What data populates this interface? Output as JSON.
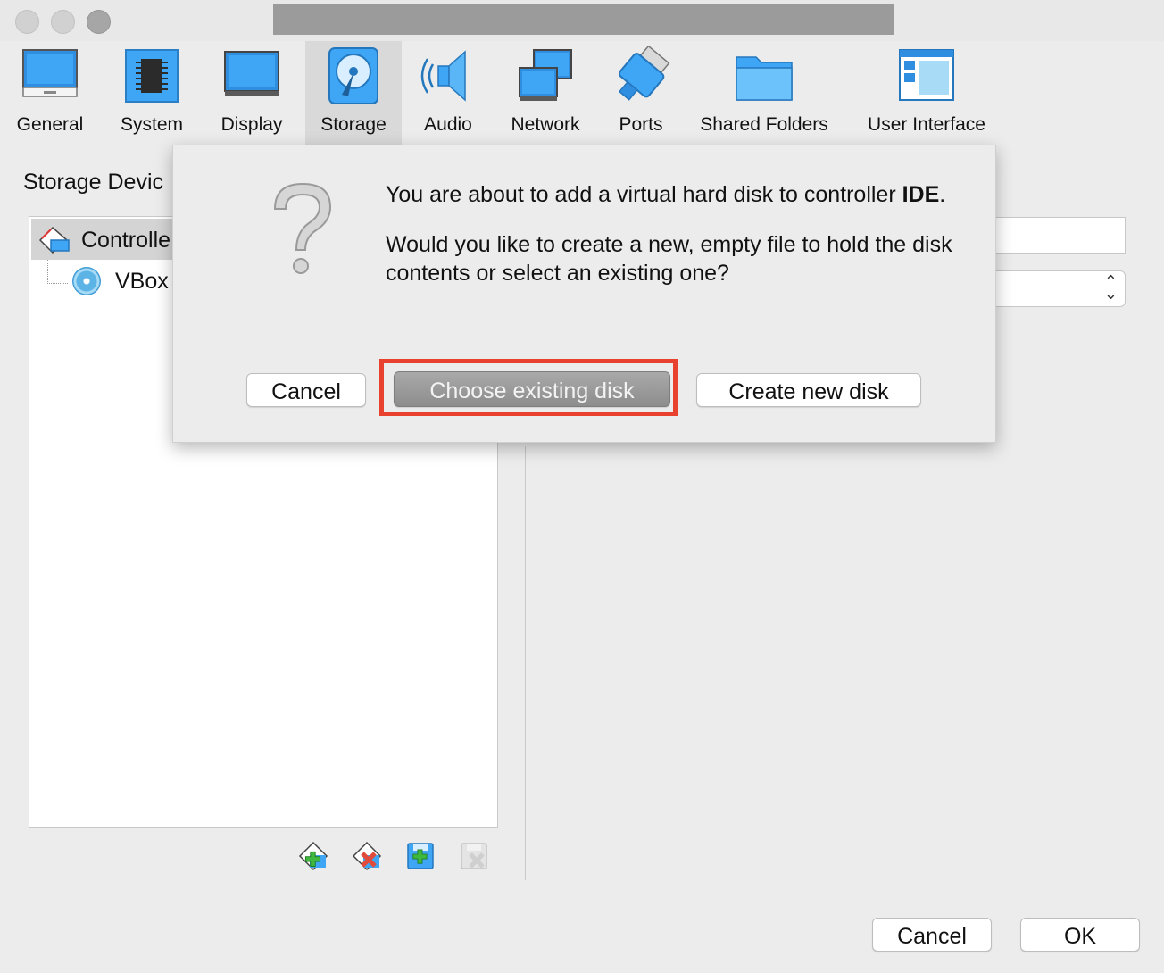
{
  "toolbar": {
    "items": [
      {
        "label": "General",
        "icon": "general-monitor-icon"
      },
      {
        "label": "System",
        "icon": "chip-icon"
      },
      {
        "label": "Display",
        "icon": "display-monitor-icon"
      },
      {
        "label": "Storage",
        "icon": "hard-disk-icon",
        "active": true
      },
      {
        "label": "Audio",
        "icon": "speaker-icon"
      },
      {
        "label": "Network",
        "icon": "network-icon"
      },
      {
        "label": "Ports",
        "icon": "port-connector-icon"
      },
      {
        "label": "Shared Folders",
        "icon": "folder-icon"
      },
      {
        "label": "User Interface",
        "icon": "window-layout-icon"
      }
    ]
  },
  "storage": {
    "section_title": "Storage Devic",
    "tree": {
      "controller_label": "Controlle",
      "disk_label": "VBox"
    }
  },
  "dialog": {
    "line1_prefix": "You are about to add a virtual hard disk to controller ",
    "controller_name": "IDE",
    "line1_suffix": ".",
    "line2": "Would you like to create a new, empty file to hold the disk contents or select an existing one?",
    "cancel_label": "Cancel",
    "choose_label": "Choose existing disk",
    "create_label": "Create new disk",
    "highlight_color": "#e8412d"
  },
  "footer": {
    "cancel_label": "Cancel",
    "ok_label": "OK"
  },
  "colors": {
    "accent_blue": "#3c9ad6",
    "window_bg": "#ececec"
  }
}
